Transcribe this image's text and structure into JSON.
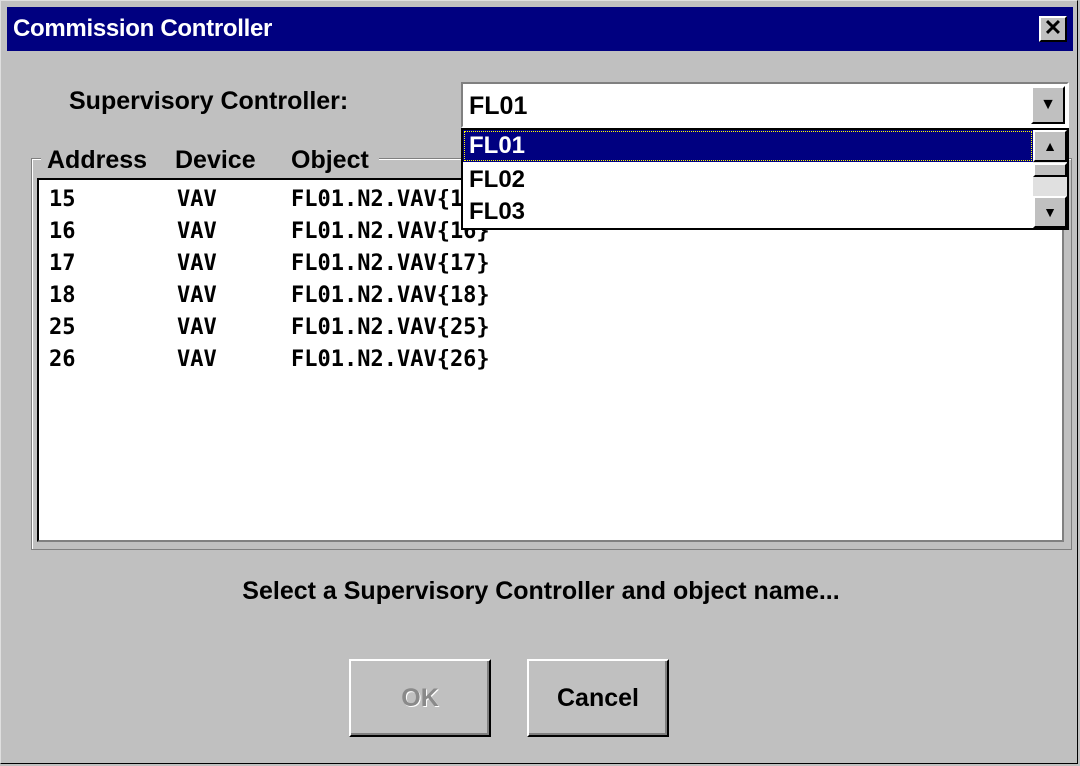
{
  "window": {
    "title": "Commission Controller",
    "close_glyph": "✕"
  },
  "supervisory": {
    "label": "Supervisory Controller:",
    "selected": "FL01",
    "options": [
      "FL01",
      "FL02",
      "FL03"
    ],
    "highlighted_index": 0
  },
  "list": {
    "headers": {
      "address": "Address",
      "device": "Device",
      "object": "Object"
    },
    "rows": [
      {
        "address": "15",
        "device": "VAV",
        "object": "FL01.N2.VAV{15}"
      },
      {
        "address": "16",
        "device": "VAV",
        "object": "FL01.N2.VAV{16}"
      },
      {
        "address": "17",
        "device": "VAV",
        "object": "FL01.N2.VAV{17}"
      },
      {
        "address": "18",
        "device": "VAV",
        "object": "FL01.N2.VAV{18}"
      },
      {
        "address": "25",
        "device": "VAV",
        "object": "FL01.N2.VAV{25}"
      },
      {
        "address": "26",
        "device": "VAV",
        "object": "FL01.N2.VAV{26}"
      }
    ]
  },
  "status_text": "Select a Supervisory Controller and object name...",
  "buttons": {
    "ok": {
      "label": "OK",
      "enabled": false
    },
    "cancel": {
      "label": "Cancel",
      "enabled": true
    }
  },
  "icons": {
    "dropdown_arrow": "▼",
    "scroll_up": "▲",
    "scroll_down": "▼"
  },
  "colors": {
    "titlebar": "#000080",
    "face": "#c0c0c0",
    "selection": "#000080"
  }
}
